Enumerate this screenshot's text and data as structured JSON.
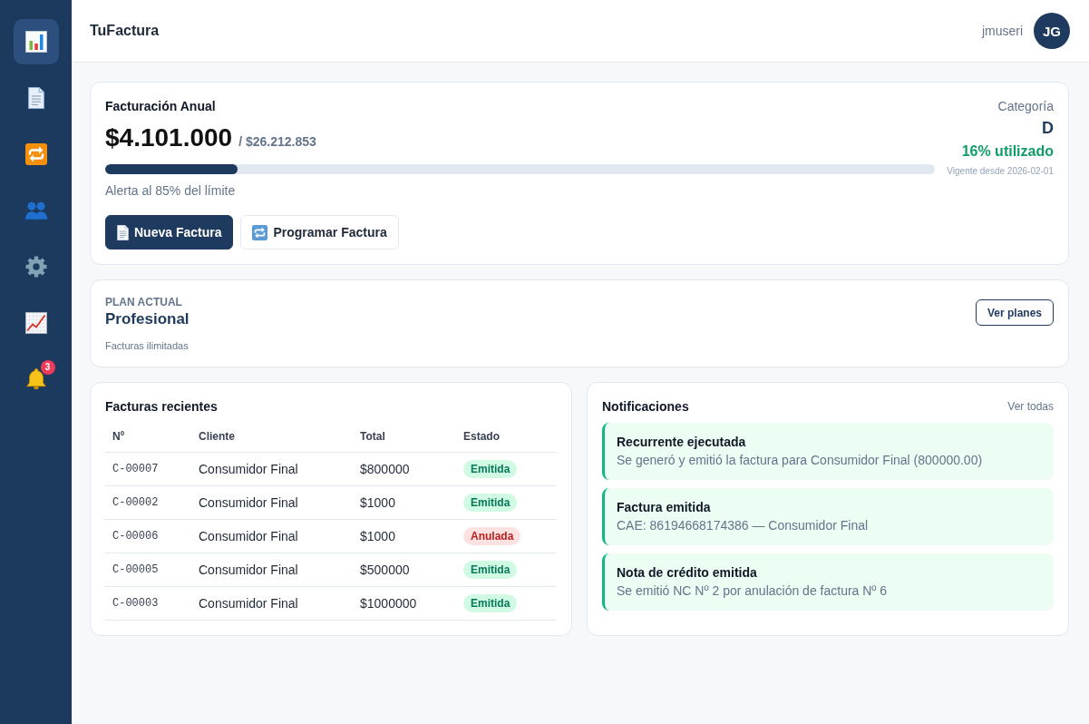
{
  "sidebar": {
    "items": [
      {
        "selected": true
      },
      {
        "selected": false
      },
      {
        "selected": false
      },
      {
        "selected": false
      },
      {
        "selected": false
      },
      {
        "selected": false
      },
      {
        "selected": false,
        "badge": "3"
      }
    ]
  },
  "header": {
    "brand": "TuFactura",
    "username": "jmuseri",
    "avatar_initials": "JG"
  },
  "billing": {
    "title": "Facturación Anual",
    "amount": "$4.101.000",
    "limit": "/ $26.212.853",
    "level": 0.16,
    "alert": "Alerta al 85% del límite",
    "category_label": "Categoría",
    "category": "D",
    "usage": "16% utilizado",
    "valid_since": "Vigente desde 2026-02-01",
    "buttons": [
      {
        "label": "Nueva Factura",
        "kind": "primary"
      },
      {
        "label": "Programar Factura",
        "kind": "secondary"
      }
    ]
  },
  "plan": {
    "eyebrow": "PLAN ACTUAL",
    "name": "Profesional",
    "detail": "Facturas ilimitadas",
    "button": "Ver planes"
  },
  "recent_invoices": {
    "title": "Facturas recientes",
    "columns": [
      "Nº",
      "Cliente",
      "Total",
      "Estado"
    ],
    "rows": [
      {
        "number": "C-00007",
        "client": "Consumidor Final",
        "total": "$800000",
        "status": {
          "label": "Emitida",
          "color": "#d1fae5"
        }
      },
      {
        "number": "C-00002",
        "client": "Consumidor Final",
        "total": "$1000",
        "status": {
          "label": "Emitida",
          "color": "#d1fae5"
        }
      },
      {
        "number": "C-00006",
        "client": "Consumidor Final",
        "total": "$1000",
        "status": {
          "label": "Anulada",
          "color": "#fee2e2"
        }
      },
      {
        "number": "C-00005",
        "client": "Consumidor Final",
        "total": "$500000",
        "status": {
          "label": "Emitida",
          "color": "#d1fae5"
        }
      },
      {
        "number": "C-00003",
        "client": "Consumidor Final",
        "total": "$1000000",
        "status": {
          "label": "Emitida",
          "color": "#d1fae5"
        }
      }
    ]
  },
  "notifications": {
    "title": "Notificaciones",
    "link": "Ver todas",
    "items": [
      {
        "title": "Recurrente ejecutada",
        "message": "Se generó y emitió la factura para Consumidor Final (800000.00)"
      },
      {
        "title": "Factura emitida",
        "message": "CAE: 86194668174386 — Consumidor Final"
      },
      {
        "title": "Nota de crédito emitida",
        "message": "Se emitió NC Nº 2 por anulación de factura Nº 6"
      }
    ]
  }
}
